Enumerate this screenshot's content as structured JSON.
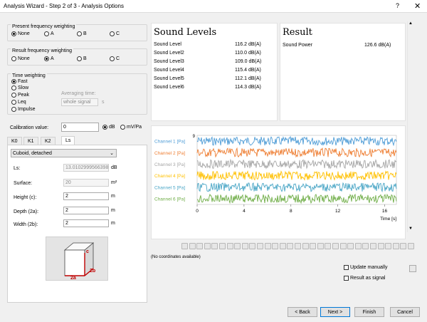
{
  "window": {
    "title": "Analysis Wizard - Step 2 of 3 - Analysis Options",
    "help": "?",
    "close": "✕"
  },
  "present_weighting": {
    "title": "Present frequency weighting",
    "options": [
      "None",
      "A",
      "B",
      "C"
    ],
    "selected": "None"
  },
  "result_weighting": {
    "title": "Result frequency weighting",
    "options": [
      "None",
      "A",
      "B",
      "C"
    ],
    "selected": "A"
  },
  "time_weighting": {
    "title": "Time weighting",
    "options": [
      "Fast",
      "Slow",
      "Peak",
      "Leq",
      "Impulse"
    ],
    "selected": "Fast",
    "averaging_label": "Averaging time:",
    "averaging_value": "whole signal",
    "averaging_unit": "s"
  },
  "calibration": {
    "label": "Calibration value:",
    "value": "0",
    "unit_db": "dB",
    "unit_mvpa": "mV/Pa",
    "selected": "dB"
  },
  "tabs": [
    "K0",
    "K1",
    "K2",
    "Ls"
  ],
  "active_tab": "Ls",
  "ls_panel": {
    "shape": "Cuboid, detached",
    "ls_label": "Ls:",
    "ls_value": "13.0102999566398",
    "ls_unit": "dB",
    "surface_label": "Surface:",
    "surface_value": "20",
    "surface_unit": "m²",
    "height_label": "Height (c):",
    "height_value": "2",
    "height_unit": "m",
    "depth_label": "Depth (2a):",
    "depth_value": "2",
    "depth_unit": "m",
    "width_label": "Width (2b):",
    "width_value": "2",
    "width_unit": "m",
    "box_labels": {
      "c": "c",
      "a": "2a",
      "b": "2b"
    }
  },
  "sound_levels": {
    "title": "Sound Levels",
    "rows": [
      {
        "name": "Sound Level",
        "value": "116.2 dB(A)"
      },
      {
        "name": "Sound Level2",
        "value": "110.0 dB(A)"
      },
      {
        "name": "Sound Level3",
        "value": "109.0 dB(A)"
      },
      {
        "name": "Sound Level4",
        "value": "115.4 dB(A)"
      },
      {
        "name": "Sound Level5",
        "value": "112.1 dB(A)"
      },
      {
        "name": "Sound Level6",
        "value": "114.3 dB(A)"
      }
    ]
  },
  "result": {
    "title": "Result",
    "rows": [
      {
        "name": "Sound Power",
        "value": "126.6 dB(A)"
      }
    ]
  },
  "chart_data": {
    "type": "line",
    "series": [
      {
        "name": "Channel 1 [Pa]",
        "color": "#4e9cd6"
      },
      {
        "name": "Channel 2 [Pa]",
        "color": "#ee7d31"
      },
      {
        "name": "Channel 3 [Pa]",
        "color": "#a5a5a5"
      },
      {
        "name": "Channel 4 [Pa]",
        "color": "#ffc000"
      },
      {
        "name": "Channel 5 [Pa]",
        "color": "#4aa6c6"
      },
      {
        "name": "Channel 6 [Pa]",
        "color": "#6fad47"
      }
    ],
    "x_ticks": [
      "0",
      "4",
      "8",
      "12",
      "16"
    ],
    "xlim": [
      0,
      17
    ],
    "y_top_label": "9",
    "xlabel": "Time [s]"
  },
  "coords_status": "(No coordinates available)",
  "options": {
    "update_manually": "Update manually",
    "result_as_signal": "Result as signal"
  },
  "buttons": {
    "back": "< Back",
    "next": "Next >",
    "finish": "Finish",
    "cancel": "Cancel"
  }
}
